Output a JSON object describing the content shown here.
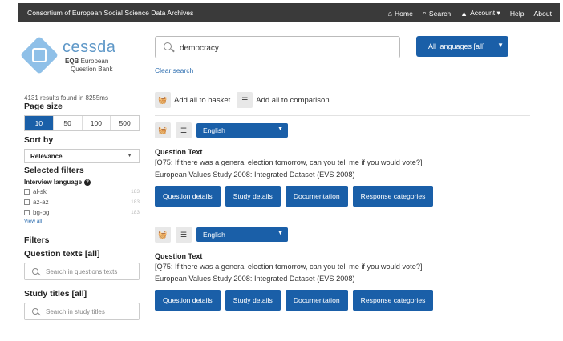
{
  "topbar": {
    "brand": "Consortium of European Social Science Data Archives",
    "nav": [
      {
        "icon": "home-icon",
        "glyph": "⌂",
        "label": "Home"
      },
      {
        "icon": "search-icon",
        "glyph": "⌕",
        "label": "Search"
      },
      {
        "icon": "user-icon",
        "glyph": "▲",
        "label": "Account ▾"
      },
      {
        "icon": "",
        "glyph": "",
        "label": "Help"
      },
      {
        "icon": "",
        "glyph": "",
        "label": "About"
      }
    ]
  },
  "logo": {
    "name": "cessda",
    "eqb": "EQB",
    "eqb_rest": " European",
    "sub": "Question Bank"
  },
  "search": {
    "value": "democracy",
    "clear": "Clear search"
  },
  "language_select": "All languages [all]",
  "sidebar": {
    "results_info": "4131 results found in 8255ms",
    "page_size_title": "Page size",
    "page_sizes": [
      "10",
      "50",
      "100",
      "500"
    ],
    "page_size_active": "10",
    "sort_title": "Sort by",
    "sort_value": "Relevance",
    "selected_filters_title": "Selected filters",
    "interview_language_title": "Interview language",
    "languages": [
      {
        "code": "al-sk",
        "count": "183"
      },
      {
        "code": "az-az",
        "count": "183"
      },
      {
        "code": "bg-bg",
        "count": "183"
      }
    ],
    "view_all": "View all",
    "filters_title": "Filters",
    "question_texts_title": "Question texts [all]",
    "question_texts_placeholder": "Search in questions texts",
    "study_titles_title": "Study titles [all]",
    "study_titles_placeholder": "Search in study titles"
  },
  "main": {
    "add_basket": "Add all to basket",
    "add_comparison": "Add all to comparison",
    "results": [
      {
        "language": "English",
        "label": "Question Text",
        "text": "[Q75: If there was a general election tomorrow, can you tell me if you would vote?]",
        "study": "European Values Study 2008: Integrated Dataset (EVS 2008)",
        "actions": [
          "Question details",
          "Study details",
          "Documentation",
          "Response categories"
        ]
      },
      {
        "language": "English",
        "label": "Question Text",
        "text": "[Q75: If there was a general election tomorrow, can you tell me if you would vote?]",
        "study": "European Values Study 2008: Integrated Dataset (EVS 2008)",
        "actions": [
          "Question details",
          "Study details",
          "Documentation",
          "Response categories"
        ]
      }
    ]
  }
}
